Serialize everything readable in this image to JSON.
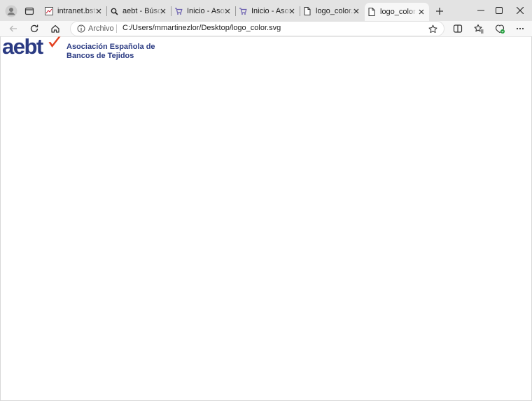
{
  "browser": {
    "tabs": [
      {
        "title": "intranet.bsta.local",
        "favicon": "image-favicon-icon",
        "active": false
      },
      {
        "title": "aebt - Búsqueda",
        "favicon": "search-icon",
        "active": false
      },
      {
        "title": "Inicio - Asociación",
        "favicon": "cart-favicon-icon",
        "active": false
      },
      {
        "title": "Inicio - Asociación",
        "favicon": "cart-favicon-icon",
        "active": false
      },
      {
        "title": "logo_color.svg",
        "favicon": "file-icon",
        "active": false
      },
      {
        "title": "logo_color.svg",
        "favicon": "file-icon",
        "active": true
      }
    ],
    "address_bar": {
      "scheme_label": "Archivo",
      "url": "C:/Users/mmartinezlor/Desktop/logo_color.svg"
    }
  },
  "page": {
    "logo": {
      "wordmark": "aebt",
      "org_line1": "Asociación Española de",
      "org_line2": "Bancos de Tejidos",
      "brand_color": "#2a3a82",
      "check_color": "#e3401f"
    }
  }
}
